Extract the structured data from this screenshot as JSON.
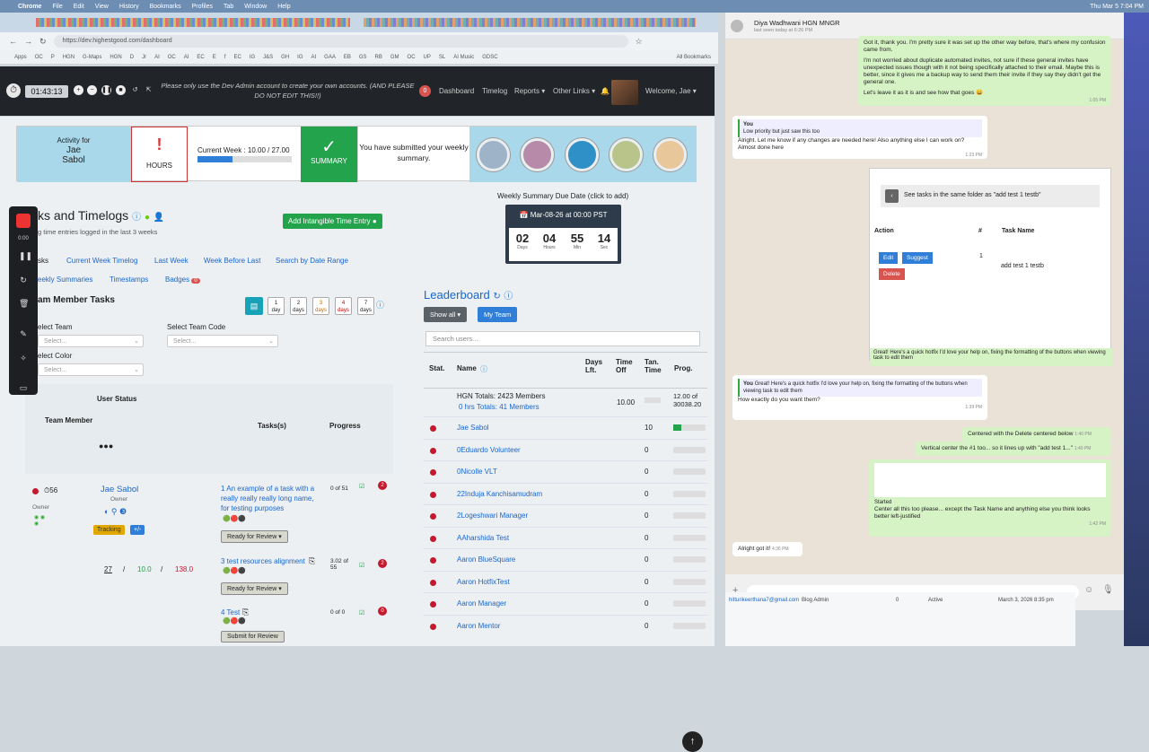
{
  "menubar": {
    "app": "Chrome",
    "items": [
      "File",
      "Edit",
      "View",
      "History",
      "Bookmarks",
      "Profiles",
      "Tab",
      "Window",
      "Help"
    ],
    "clock": "Thu Mar 5 7:04 PM"
  },
  "browser": {
    "url": "https://dev.highestgood.com/dashboard",
    "bookmarks": [
      "Apps",
      "OC",
      "P",
      "HGN",
      "G-Maps",
      "HGN",
      "D",
      "Jr",
      "AI",
      "OC",
      "AI",
      "EC",
      "E",
      "f",
      "EC",
      "IG",
      "J&S",
      "GH",
      "IG",
      "AI",
      "GAA",
      "EB",
      "GS",
      "RB",
      "GM",
      "OC",
      "UP",
      "SL",
      "AI Music",
      "GDSC"
    ],
    "all_bookmarks": "All Bookmarks"
  },
  "nav": {
    "timer": "01:43:13",
    "notice": "Please only use the Dev Admin account to create your own accounts. (AND PLEASE DO NOT EDIT THIS!!)",
    "notif_count": "0",
    "links": [
      "Dashboard",
      "Timelog",
      "Reports ▾",
      "Other Links ▾"
    ],
    "welcome": "Welcome, Jae ▾"
  },
  "activity": {
    "label": "Activity for",
    "name_first": "Jae",
    "name_last": "Sabol",
    "hours_label": "HOURS",
    "week_label": "Current Week : 10.00 / 27.00",
    "week_progress": 0.37,
    "summary_label": "SUMMARY",
    "submitted_text": "You have submitted your weekly summary."
  },
  "recorder": {
    "time": "0:00"
  },
  "tasks": {
    "title": "ks and Timelogs",
    "subtitle": "g time entries logged in the last 3 weeks",
    "add_btn": "Add Intangible Time Entry",
    "tabs": [
      "sks",
      "Current Week Timelog",
      "Last Week",
      "Week Before Last",
      "Search by Date Range"
    ],
    "tabs2": [
      "eekly Summaries",
      "Timestamps",
      "Badges"
    ],
    "badges_count": "0",
    "team_tasks": "am Member Tasks",
    "day_btns": [
      {
        "n": "1",
        "l": "day"
      },
      {
        "n": "2",
        "l": "days"
      },
      {
        "n": "3",
        "l": "days"
      },
      {
        "n": "4",
        "l": "days"
      },
      {
        "n": "7",
        "l": "days"
      }
    ],
    "select_team": "elect Team",
    "select_team_code": "Select Team Code",
    "select_color": "elect Color",
    "select_ph": "Select...",
    "user_status": "User Status",
    "team_member": "Team Member",
    "tasks_col": "Tasks(s)",
    "progress_col": "Progress",
    "member_hours": "56",
    "member_name": "Jae Sabol",
    "member_role": "Owner",
    "tracking": "Tracking",
    "plus": "+/-",
    "totals": {
      "a": "27",
      "b": "10.0",
      "c": "138.0",
      "sep": "/"
    },
    "task_list": [
      {
        "name": "1 An example of a task with a really really really long name, for testing purposes",
        "prog": "0 of 51",
        "btn": "Ready for Review ▾",
        "badge": "2"
      },
      {
        "name": "3 test resources alignment",
        "prog": "3.02 of 55",
        "btn": "Ready for Review ▾",
        "badge": "2"
      },
      {
        "name": "4 Test",
        "prog": "0 of 0",
        "btn": "Submit for Review",
        "badge": "0"
      }
    ]
  },
  "countdown": {
    "due_label": "Weekly Summary Due Date (click to add)",
    "date": "Mar-08-26 at 00:00 PST",
    "cells": [
      {
        "n": "02",
        "l": "Days"
      },
      {
        "n": "04",
        "l": "Hours"
      },
      {
        "n": "55",
        "l": "Min"
      },
      {
        "n": "14",
        "l": "Sec"
      }
    ]
  },
  "leaderboard": {
    "title": "Leaderboard",
    "show_all": "Show all ▾",
    "my_team": "My Team",
    "search_ph": "Search users...",
    "cols": {
      "stat": "Stat.",
      "name": "Name",
      "days": "Days Lft.",
      "off": "Time Off",
      "tan": "Tan. Time",
      "prog": "Prog."
    },
    "totals_line1": "HGN Totals: 2423 Members",
    "totals_line2": "0 hrs Totals: 41 Members",
    "totals_off": "10.00",
    "totals_prog": "12.00 of 30038.20",
    "rows": [
      {
        "name": "Jae Sabol",
        "val": "10",
        "fill": 0.25
      },
      {
        "name": "0Eduardo Volunteer",
        "val": "0",
        "fill": 0
      },
      {
        "name": "0Nicolle VLT",
        "val": "0",
        "fill": 0
      },
      {
        "name": "22Induja Kanchisamudram",
        "val": "0",
        "fill": 0
      },
      {
        "name": "2Logeshwari Manager",
        "val": "0",
        "fill": 0
      },
      {
        "name": "AAharshida Test",
        "val": "0",
        "fill": 0
      },
      {
        "name": "Aaron BlueSquare",
        "val": "0",
        "fill": 0
      },
      {
        "name": "Aaron HotfixTest",
        "val": "0",
        "fill": 0
      },
      {
        "name": "Aaron Manager",
        "val": "0",
        "fill": 0
      },
      {
        "name": "Aaron Mentor",
        "val": "0",
        "fill": 0
      }
    ]
  },
  "chat": {
    "contact": "Diya Wadhwani HGN MNGR",
    "last_seen": "last seen today at 6:26 PM",
    "m1": "Got it, thank you. I'm pretty sure it was set up the other way before, that's where my confusion came from.",
    "m1b": "I'm not worried about duplicate automated invites, not sure if these general invites have unexpected issues though with it not being specifically attached to their email. Maybe this is better, since it gives me a backup way to send them their invite if they say they didn't get the general one.",
    "m1c": "Let's leave it as it is and see how that goes 😄",
    "t1": "1:05 PM",
    "q_you": "You",
    "q_text": "Low priority but just saw this too",
    "m2": "Alright. Let me know if any changes are needed here! Also anything else I can work on? Almost done here",
    "t2": "1:23 PM",
    "shot_title": "See tasks in the same folder as \"add test 1 testb\"",
    "shot_action": "Action",
    "shot_hash": "#",
    "shot_task": "Task Name",
    "shot_edit": "Edit",
    "shot_suggest": "Suggest",
    "shot_delete": "Delete",
    "shot_num": "1",
    "shot_taskname": "add test 1 testb",
    "m3": "Great! Here's a quick hotfix I'd love your help on, fixing the formatting of the buttons when viewing task to edit them",
    "t3": "1:37 PM",
    "q2_you": "You",
    "q2_text": "Great! Here's a quick hotfix I'd love your help on, fixing the formatting of the buttons when viewing task to edit them",
    "m4": "How exactly do you want them?",
    "t4": "1:39 PM",
    "m5": "Centered with the Delete centered below",
    "t5": "1:40 PM",
    "m6": "Vertical center the #1 too... so it lines up with \"add test 1...\"",
    "t6": "1:40 PM",
    "m7": "Center all this too please... except the Task Name and anything else you think looks better left-justified",
    "t7": "1:42 PM",
    "m7_started": "Started",
    "m8": "Alright got it!",
    "t8": "4:36 PM"
  },
  "bgtable": {
    "email": "hitturikeerthana7@gmail.com",
    "role": "Blog Admin",
    "num": "0",
    "status": "Active",
    "date": "March 3, 2026 8:35 pm"
  }
}
